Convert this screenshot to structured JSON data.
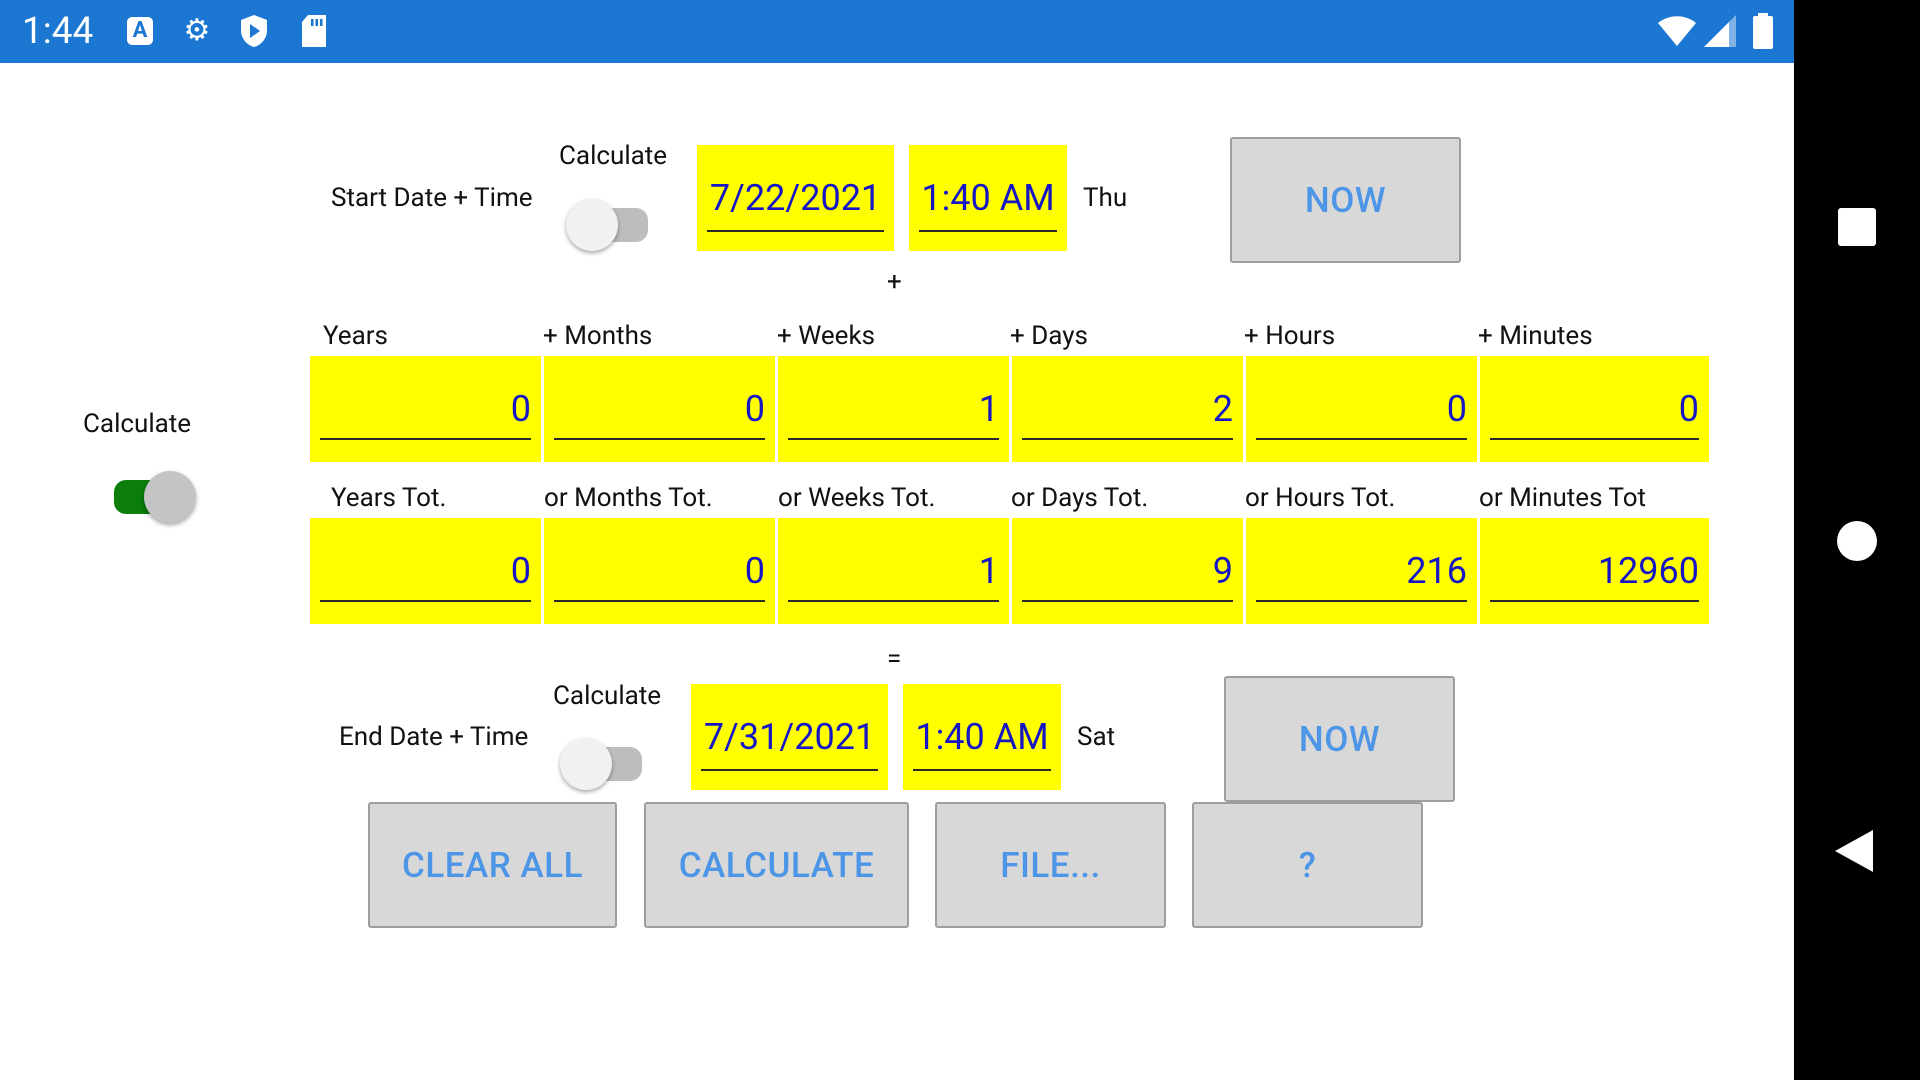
{
  "status_bar": {
    "time": "1:44",
    "icons": [
      "text-a-icon",
      "gear-icon",
      "shield-play-icon",
      "sd-card-icon",
      "wifi-icon",
      "signal-icon",
      "battery-icon"
    ],
    "color": "#1b77d2"
  },
  "start": {
    "label": "Start Date + Time",
    "calc_label": "Calculate",
    "calc_on": false,
    "date": "7/22/2021",
    "time": "1:40 AM",
    "weekday": "Thu",
    "now_label": "NOW"
  },
  "plus_sign": "+",
  "duration": {
    "calc_label": "Calculate",
    "calc_on": true,
    "headers": [
      "Years",
      "+ Months",
      "+ Weeks",
      "+ Days",
      "+ Hours",
      "+ Minutes"
    ],
    "values": [
      "0",
      "0",
      "1",
      "2",
      "0",
      "0"
    ],
    "total_headers": [
      "Years Tot.",
      "or Months Tot.",
      "or Weeks Tot.",
      "or Days Tot.",
      "or Hours Tot.",
      "or Minutes Tot"
    ],
    "totals": [
      "0",
      "0",
      "1",
      "9",
      "216",
      "12960"
    ]
  },
  "equals_sign": "=",
  "end": {
    "label": "End Date + Time",
    "calc_label": "Calculate",
    "calc_on": false,
    "date": "7/31/2021",
    "time": "1:40 AM",
    "weekday": "Sat",
    "now_label": "NOW"
  },
  "actions": {
    "clear_all": "CLEAR ALL",
    "calculate": "CALCULATE",
    "file": "FILE...",
    "help": "?"
  },
  "colors": {
    "field_bg": "#ffff00",
    "field_text": "#1616c6",
    "button_bg": "#d8d8d8",
    "button_text": "#4d95e6",
    "toggle_on": "#0b7d0b"
  }
}
